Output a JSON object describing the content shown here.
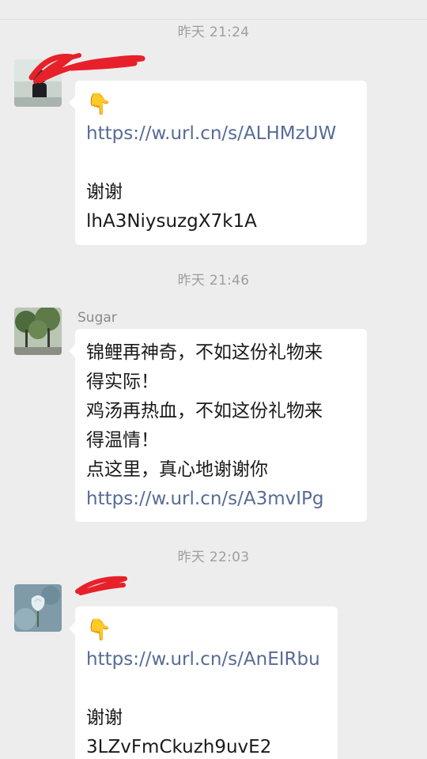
{
  "messages": [
    {
      "timestamp": "昨天 21:24",
      "sender": "",
      "pointer_icon": "👇",
      "link": "https://w.url.cn/s/ALHMzUW",
      "text1": "谢谢",
      "text2": "lhA3NiysuzgX7k1A"
    },
    {
      "timestamp": "昨天 21:46",
      "sender": "Sugar",
      "lines": [
        "锦鲤再神奇，不如这份礼物来",
        "得实际！",
        "鸡汤再热血，不如这份礼物来",
        "得温情！",
        "点这里，真心地谢谢你"
      ],
      "link": "https://w.url.cn/s/A3mvIPg"
    },
    {
      "timestamp": "昨天 22:03",
      "sender": "",
      "pointer_icon": "👇",
      "link": "https://w.url.cn/s/AnEIRbu",
      "text1": "谢谢",
      "text2": "3LZvFmCkuzh9uvE2"
    }
  ],
  "colors": {
    "background": "#ededed",
    "bubble": "#ffffff",
    "link": "#576b95",
    "timestamp": "#9e9e9e",
    "redaction": "#e8202a"
  }
}
